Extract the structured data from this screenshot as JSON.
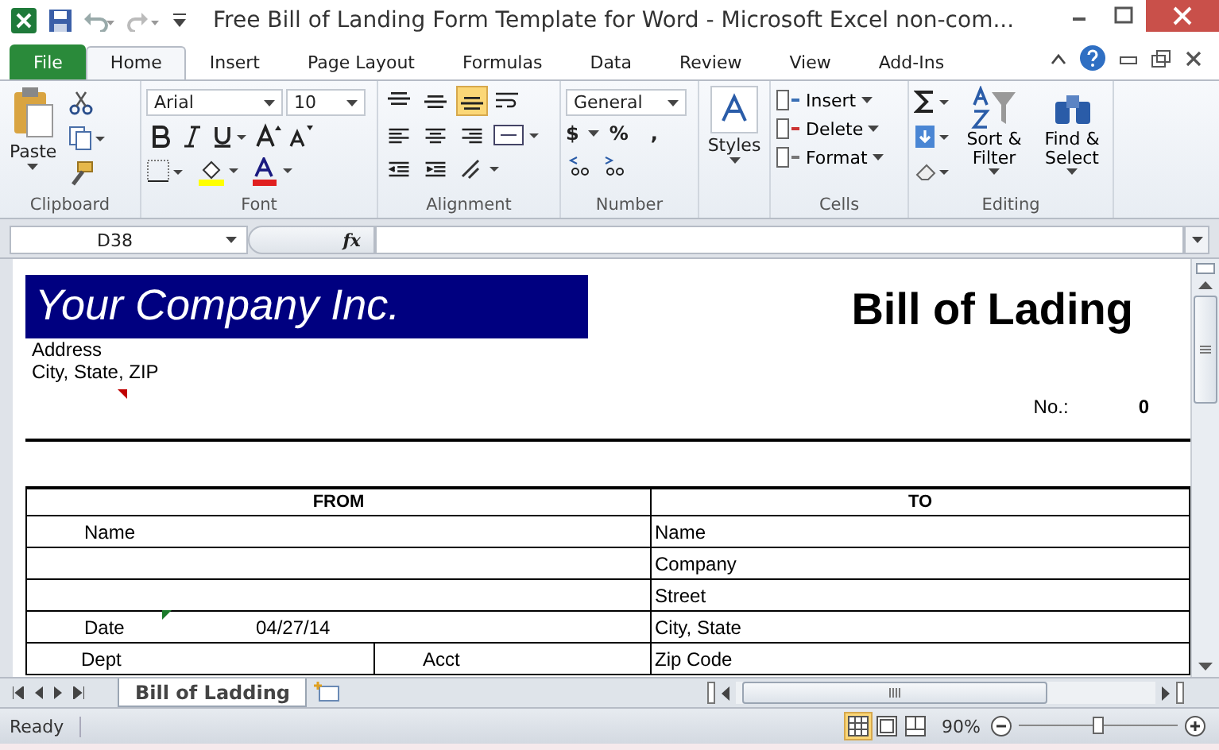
{
  "window": {
    "title": "Free Bill of Landing Form Template for Word  -  Microsoft Excel non-com..."
  },
  "ribbon_tabs": [
    {
      "label": "File",
      "kind": "file",
      "selected": false
    },
    {
      "label": "Home",
      "kind": "tab",
      "selected": true
    },
    {
      "label": "Insert",
      "kind": "tab",
      "selected": false
    },
    {
      "label": "Page Layout",
      "kind": "tab",
      "selected": false
    },
    {
      "label": "Formulas",
      "kind": "tab",
      "selected": false
    },
    {
      "label": "Data",
      "kind": "tab",
      "selected": false
    },
    {
      "label": "Review",
      "kind": "tab",
      "selected": false
    },
    {
      "label": "View",
      "kind": "tab",
      "selected": false
    },
    {
      "label": "Add-Ins",
      "kind": "tab",
      "selected": false
    }
  ],
  "clipboard": {
    "label": "Clipboard",
    "paste": "Paste"
  },
  "font": {
    "label": "Font",
    "name": "Arial",
    "size": "10"
  },
  "alignment": {
    "label": "Alignment",
    "vertical": [
      {
        "kind": "top",
        "selected": false
      },
      {
        "kind": "middle",
        "selected": false
      },
      {
        "kind": "bottom",
        "selected": true
      }
    ]
  },
  "number": {
    "label": "Number",
    "format": "General",
    "currency": "$",
    "percent": "%",
    "comma": ","
  },
  "styles": {
    "label": "Styles"
  },
  "cells": {
    "label": "Cells",
    "buttons": [
      "Insert",
      "Delete",
      "Format"
    ]
  },
  "editing": {
    "label": "Editing",
    "sort": "Sort & Filter",
    "find": "Find & Select"
  },
  "formula_bar": {
    "name_box": "D38",
    "function_label": "fx"
  },
  "sheet": {
    "company": "Your Company Inc.",
    "address": "Address",
    "city_state_zip": "City, State, ZIP",
    "title": "Bill of Lading",
    "number_label": "No.:",
    "number": "0",
    "from_header": "FROM",
    "to_header": "TO",
    "rows": [
      {
        "split": false,
        "from": [
          "Name"
        ],
        "to": "Name"
      },
      {
        "split": false,
        "from": [],
        "to": "Company"
      },
      {
        "split": false,
        "from": [],
        "to": "Street"
      },
      {
        "split": false,
        "from": [
          "Date",
          "04/27/14"
        ],
        "to": "City, State"
      },
      {
        "split": true,
        "from": [
          "Dept",
          "Acct"
        ],
        "to": "Zip Code"
      }
    ]
  },
  "sheet_tabs": [
    {
      "label": "Bill of Ladding",
      "selected": true
    }
  ],
  "status_bar": {
    "text": "Ready",
    "views": [
      {
        "kind": "normal",
        "selected": true
      },
      {
        "kind": "layout",
        "selected": false
      },
      {
        "kind": "break",
        "selected": false
      }
    ],
    "zoom": "90%",
    "zoom_slider": {
      "level": 0.5
    }
  }
}
